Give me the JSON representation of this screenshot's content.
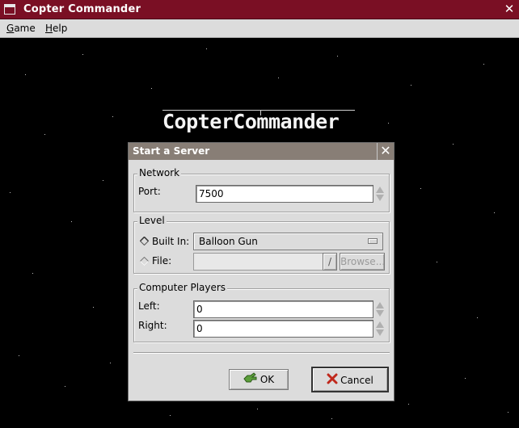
{
  "window": {
    "title": "Copter Commander"
  },
  "menubar": {
    "items": [
      {
        "label": "Game",
        "accel": "G",
        "rest": "ame"
      },
      {
        "label": "Help",
        "accel": "H",
        "rest": "elp"
      }
    ]
  },
  "logo": {
    "text": "CopterCommander"
  },
  "dialog": {
    "title": "Start a Server",
    "network": {
      "section_label": "Network",
      "port_label": "Port:",
      "port_value": "7500"
    },
    "level": {
      "section_label": "Level",
      "builtin_label": "Built In:",
      "builtin_value": "Balloon Gun",
      "builtin_selected": true,
      "file_label": "File:",
      "file_value": "",
      "browse_label": "Browse..."
    },
    "computer_players": {
      "section_label": "Computer Players",
      "left_label": "Left:",
      "left_value": "0",
      "right_label": "Right:",
      "right_value": "0"
    },
    "buttons": {
      "ok_label": "OK",
      "cancel_label": "Cancel"
    }
  },
  "icons": {
    "window": "window-icon",
    "close": "close-icon",
    "ok": "ok-hand-icon",
    "cancel": "cancel-x-icon",
    "file_picker": "file-picker-icon"
  },
  "colors": {
    "titlebar": "#7a0f24",
    "dialog_title": "#887e76",
    "background": "#000000",
    "dialog": "#dcdcdc"
  }
}
